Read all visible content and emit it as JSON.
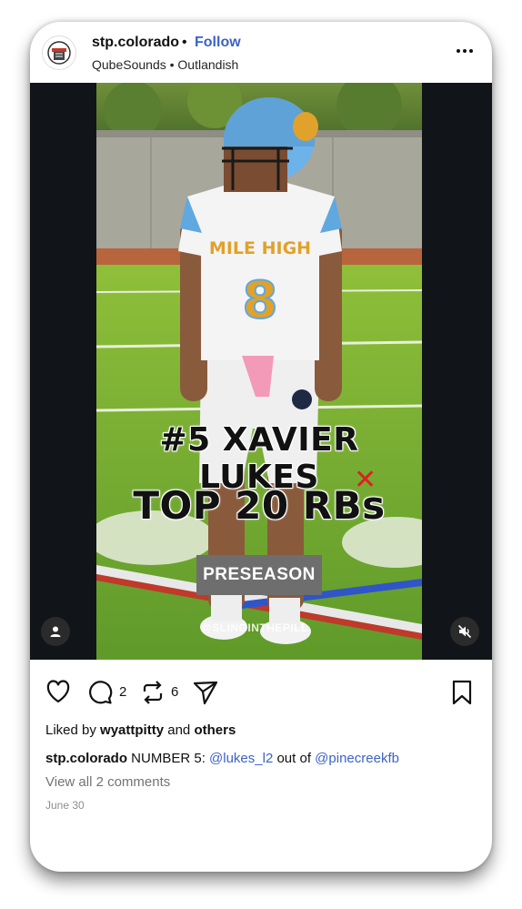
{
  "post": {
    "username": "stp.colorado",
    "separator": "•",
    "follow_label": "Follow",
    "audio": "QubeSounds • Outlandish",
    "avatar_icon": "team-logo-icon"
  },
  "media": {
    "overlay_line1": "#5 XAVIER LUKES",
    "overlay_x": "✕",
    "overlay_line2": "TOP 20 RBs",
    "badge": "PRESEASON",
    "watermark": "@SLINGINTHEPILL",
    "jersey_text": "MILE HIGH",
    "jersey_number": "8"
  },
  "actions": {
    "comment_count": "2",
    "repost_count": "6"
  },
  "likes": {
    "prefix": "Liked by ",
    "user": "wyattpitty",
    "middle": " and ",
    "others": "others"
  },
  "caption": {
    "user": "stp.colorado",
    "text1": " NUMBER 5: ",
    "mention1": "@lukes_l2",
    "text2": " out of ",
    "mention2": "@pinecreekfb"
  },
  "comments_link": "View all 2 comments",
  "date": "June 30",
  "colors": {
    "link": "#3b63c8",
    "accent_red": "#d9231f",
    "badge_gray": "#6e6e6e"
  }
}
